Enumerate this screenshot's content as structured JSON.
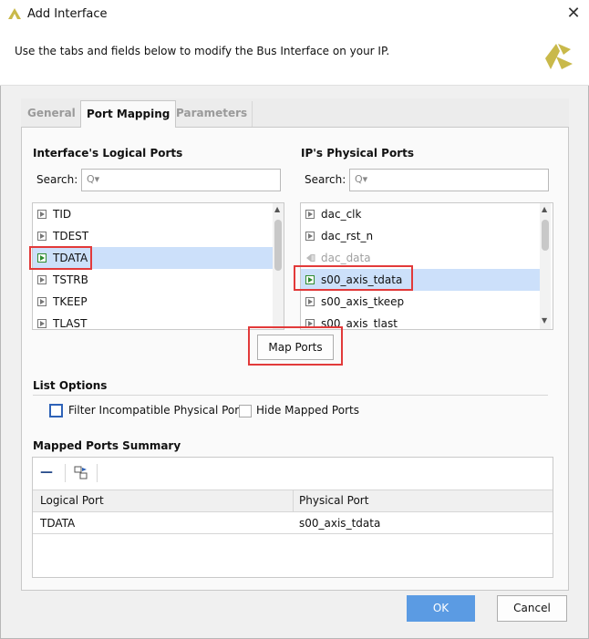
{
  "window": {
    "title": "Add Interface",
    "close_glyph": "✕"
  },
  "banner": {
    "text": "Use the tabs and fields below to modify the Bus Interface on your IP."
  },
  "tabs": [
    {
      "label": "General",
      "active": false
    },
    {
      "label": "Port Mapping",
      "active": true
    },
    {
      "label": "Parameters",
      "active": false
    }
  ],
  "logical_ports": {
    "title": "Interface's Logical Ports",
    "search_label": "Search:",
    "search_glyph": "Q▾",
    "items": [
      {
        "label": "TID",
        "selected": false
      },
      {
        "label": "TDEST",
        "selected": false
      },
      {
        "label": "TDATA",
        "selected": true
      },
      {
        "label": "TSTRB",
        "selected": false
      },
      {
        "label": "TKEEP",
        "selected": false
      },
      {
        "label": "TLAST",
        "selected": false
      }
    ]
  },
  "physical_ports": {
    "title": "IP's Physical Ports",
    "search_label": "Search:",
    "search_glyph": "Q▾",
    "items": [
      {
        "label": "dac_clk",
        "selected": false,
        "dimmed": false
      },
      {
        "label": "dac_rst_n",
        "selected": false,
        "dimmed": false
      },
      {
        "label": "dac_data",
        "selected": false,
        "dimmed": true
      },
      {
        "label": "s00_axis_tdata",
        "selected": true,
        "dimmed": false
      },
      {
        "label": "s00_axis_tkeep",
        "selected": false,
        "dimmed": false
      },
      {
        "label": "s00_axis_tlast",
        "selected": false,
        "dimmed": false
      }
    ]
  },
  "map_ports_button": {
    "label": "Map Ports"
  },
  "list_options": {
    "title": "List Options",
    "filter_label": "Filter Incompatible Physical Ports",
    "hide_label": "Hide Mapped Ports",
    "filter_checked": false,
    "hide_checked": false
  },
  "mapped_summary": {
    "title": "Mapped Ports Summary",
    "remove_glyph": "—",
    "columns": [
      "Logical Port",
      "Physical Port"
    ],
    "rows": [
      [
        "TDATA",
        "s00_axis_tdata"
      ]
    ]
  },
  "footer": {
    "ok_label": "OK",
    "cancel_label": "Cancel"
  },
  "colors": {
    "accent": "#5b9be3",
    "highlight": "#e23a3a",
    "selection": "#cce0fa",
    "logo_yellow": "#c9b94a"
  }
}
